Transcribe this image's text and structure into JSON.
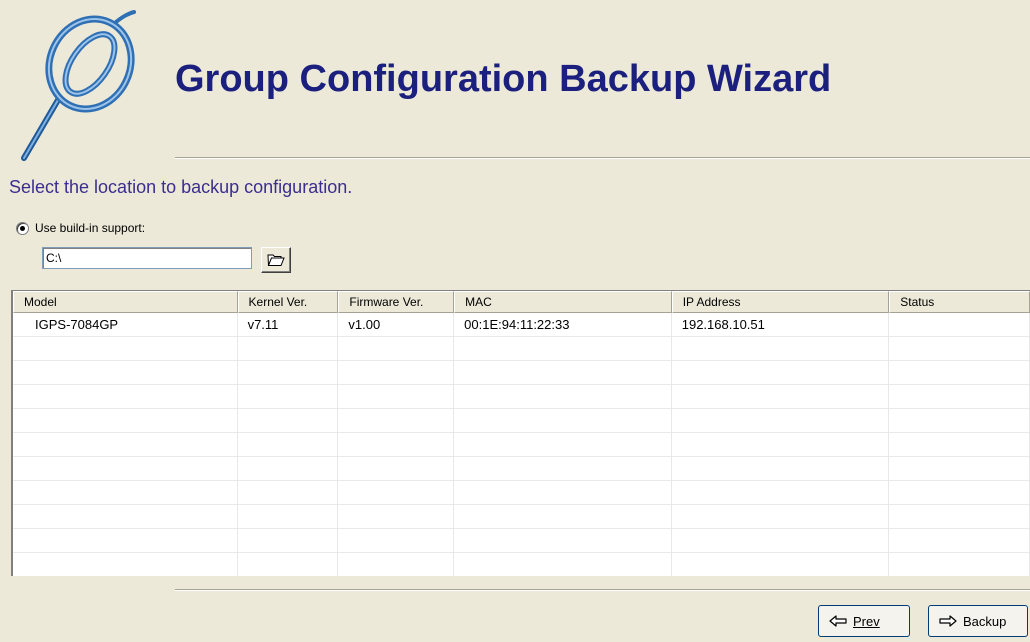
{
  "wizard": {
    "title": "Group Configuration Backup Wizard",
    "instruction": "Select the location to backup configuration."
  },
  "location": {
    "radio_label": "Use build-in support:",
    "radio_checked": true,
    "path_value": "C:\\",
    "browse_icon": "folder-open-icon"
  },
  "table": {
    "columns": [
      "Model",
      "Kernel Ver.",
      "Firmware Ver.",
      "MAC",
      "IP Address",
      "Status"
    ],
    "rows": [
      {
        "model": "IGPS-7084GP",
        "kernel": "v7.11",
        "firmware": "v1.00",
        "mac": "00:1E:94:11:22:33",
        "ip": "192.168.10.51",
        "status": ""
      }
    ]
  },
  "buttons": {
    "prev_label": "Prev",
    "backup_label": "Backup",
    "prev_icon": "arrow-left-icon",
    "backup_icon": "arrow-right-icon"
  },
  "colors": {
    "title": "#1b1f7d",
    "instruction": "#3b2e8f",
    "logo": "#2f6fb4",
    "window_bg": "#ece9d8"
  }
}
